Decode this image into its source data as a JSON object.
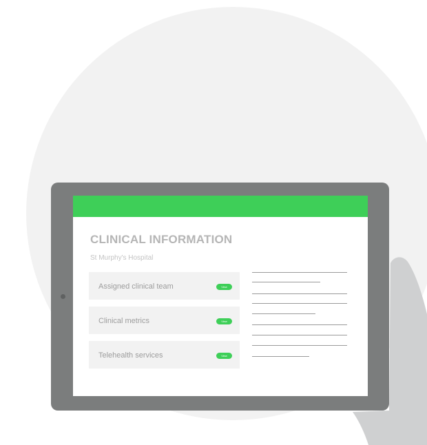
{
  "screen": {
    "title": "CLINICAL INFORMATION",
    "subtitle": "St Murphy's Hospital",
    "header_color": "#3ecf58",
    "items": [
      {
        "label": "Assigned clinical team",
        "button": "View"
      },
      {
        "label": "Clinical metrics",
        "button": "View"
      },
      {
        "label": "Telehealth services",
        "button": "View"
      }
    ]
  },
  "colors": {
    "accent": "#3ecf58",
    "tablet_frame": "#7b7d7d",
    "background_circle": "#f2f2f2",
    "hand": "#cfd0d1"
  }
}
